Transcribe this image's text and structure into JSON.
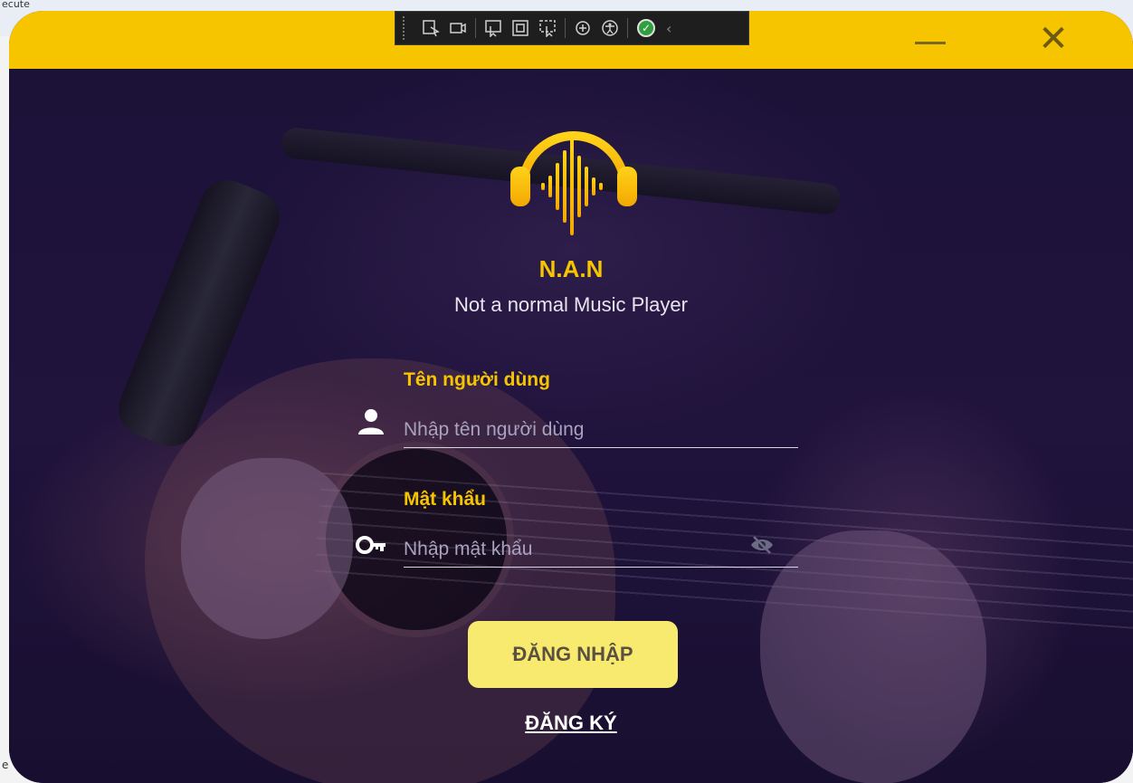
{
  "host": {
    "top_fragment": "ecute",
    "bottom_fragment": "e"
  },
  "window": {
    "minimize_glyph": "—",
    "close_glyph": "✕"
  },
  "devbar": {
    "tools": [
      "select-element-icon",
      "record-icon",
      "pointer-icon",
      "frame-icon",
      "track-focus-icon",
      "binding-icon",
      "accessibility-icon"
    ],
    "status": "✓",
    "collapse": "‹"
  },
  "app": {
    "name": "N.A.N",
    "tagline": "Not a normal Music Player"
  },
  "form": {
    "username_label": "Tên người dùng",
    "username_placeholder": "Nhập tên người dùng",
    "username_value": "",
    "password_label": "Mật khẩu",
    "password_placeholder": "Nhập mật khẩu",
    "password_value": "",
    "login_label": "ĐĂNG NHẬP",
    "register_label": "ĐĂNG KÝ"
  },
  "colors": {
    "accent": "#f7c500",
    "button": "#f8ea6e",
    "background": "#1a1033"
  }
}
